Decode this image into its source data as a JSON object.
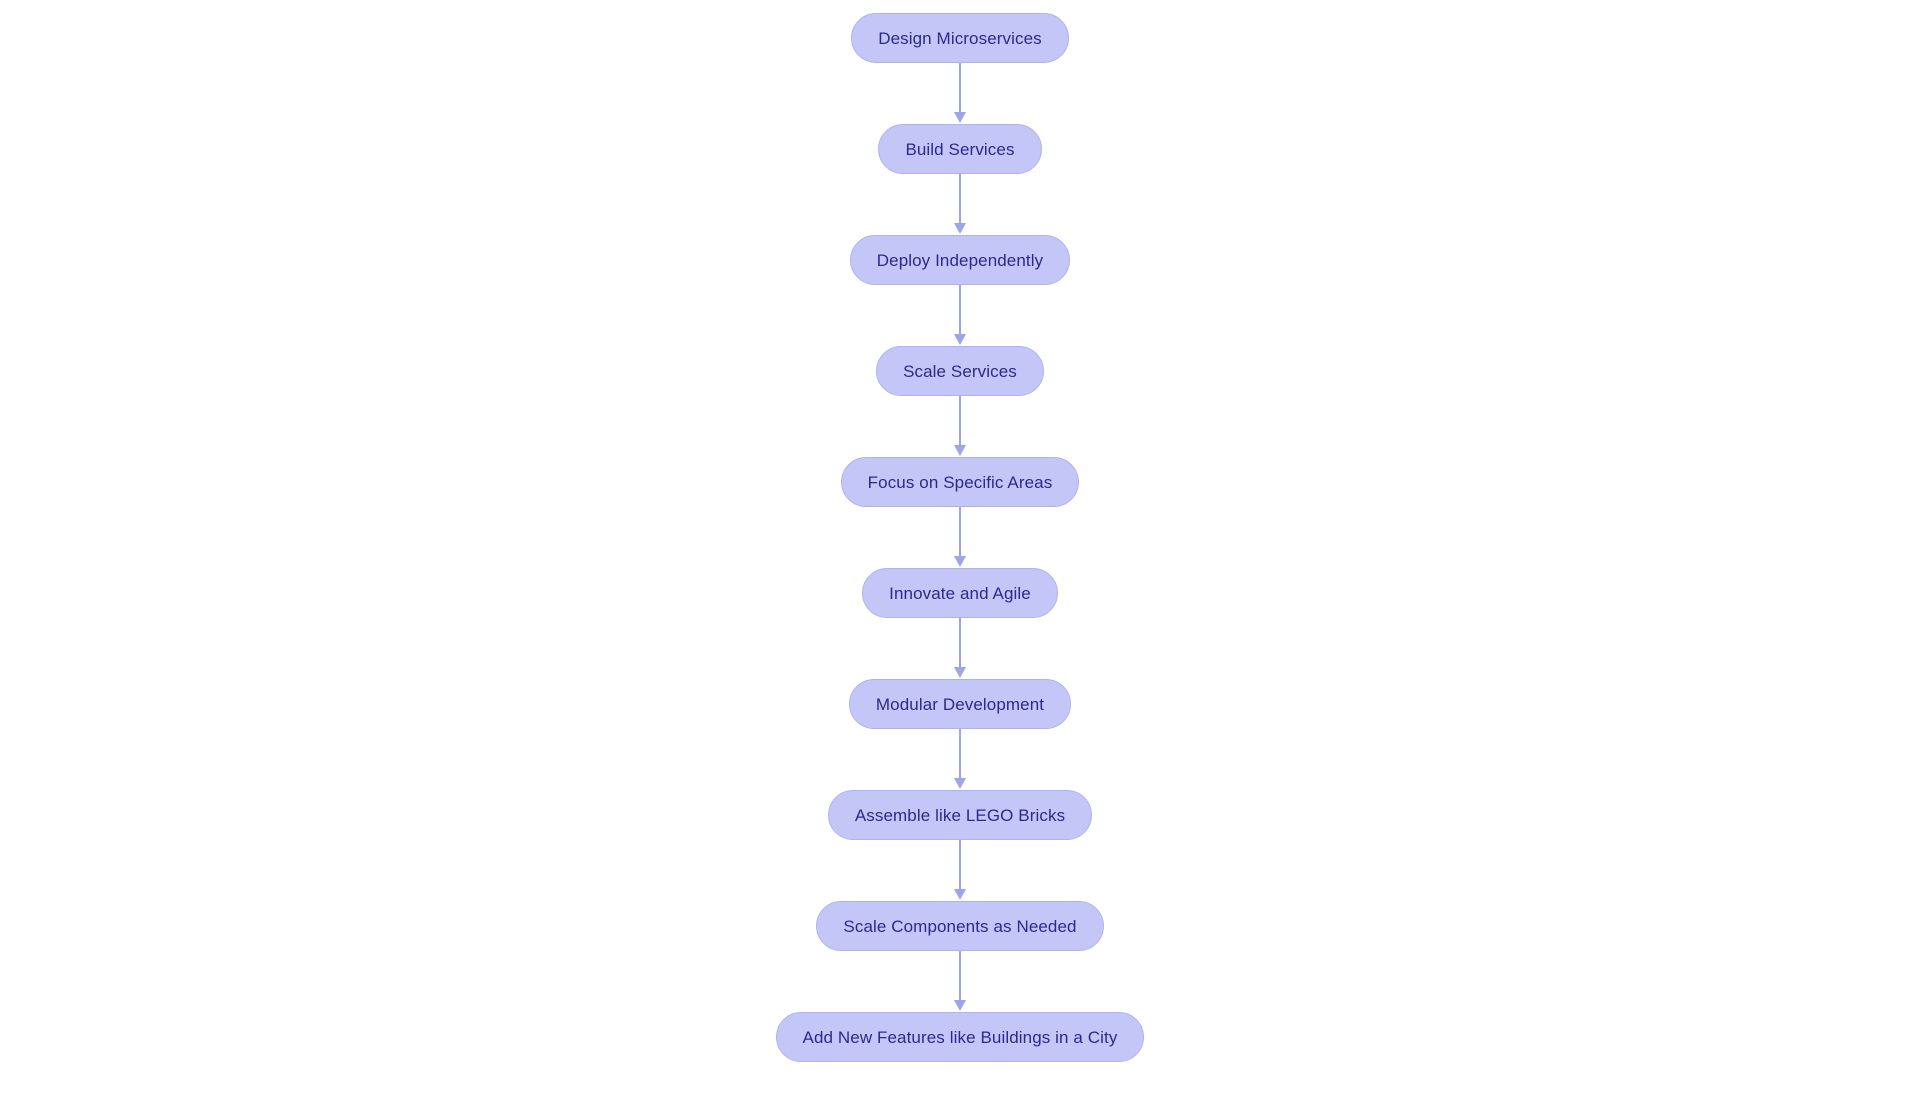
{
  "diagram": {
    "type": "flowchart",
    "orientation": "top-to-bottom",
    "background_color": "#ffffff",
    "node_fill_color": "#c5c6f8",
    "node_border_color": "#b0b2f0",
    "node_text_color": "#2a2a8c",
    "connector_color": "#9fa4e8",
    "node_shape": "stadium",
    "nodes": [
      {
        "id": "n1",
        "label": "Design Microservices"
      },
      {
        "id": "n2",
        "label": "Build Services"
      },
      {
        "id": "n3",
        "label": "Deploy Independently"
      },
      {
        "id": "n4",
        "label": "Scale Services"
      },
      {
        "id": "n5",
        "label": "Focus on Specific Areas"
      },
      {
        "id": "n6",
        "label": "Innovate and Agile"
      },
      {
        "id": "n7",
        "label": "Modular Development"
      },
      {
        "id": "n8",
        "label": "Assemble like LEGO Bricks"
      },
      {
        "id": "n9",
        "label": "Scale Components as Needed"
      },
      {
        "id": "n10",
        "label": "Add New Features like Buildings in a City"
      }
    ],
    "edges": [
      {
        "from": "n1",
        "to": "n2",
        "label": ""
      },
      {
        "from": "n2",
        "to": "n3",
        "label": ""
      },
      {
        "from": "n3",
        "to": "n4",
        "label": ""
      },
      {
        "from": "n4",
        "to": "n5",
        "label": ""
      },
      {
        "from": "n5",
        "to": "n6",
        "label": ""
      },
      {
        "from": "n6",
        "to": "n7",
        "label": ""
      },
      {
        "from": "n7",
        "to": "n8",
        "label": ""
      },
      {
        "from": "n8",
        "to": "n9",
        "label": ""
      },
      {
        "from": "n9",
        "to": "n10",
        "label": ""
      }
    ]
  }
}
